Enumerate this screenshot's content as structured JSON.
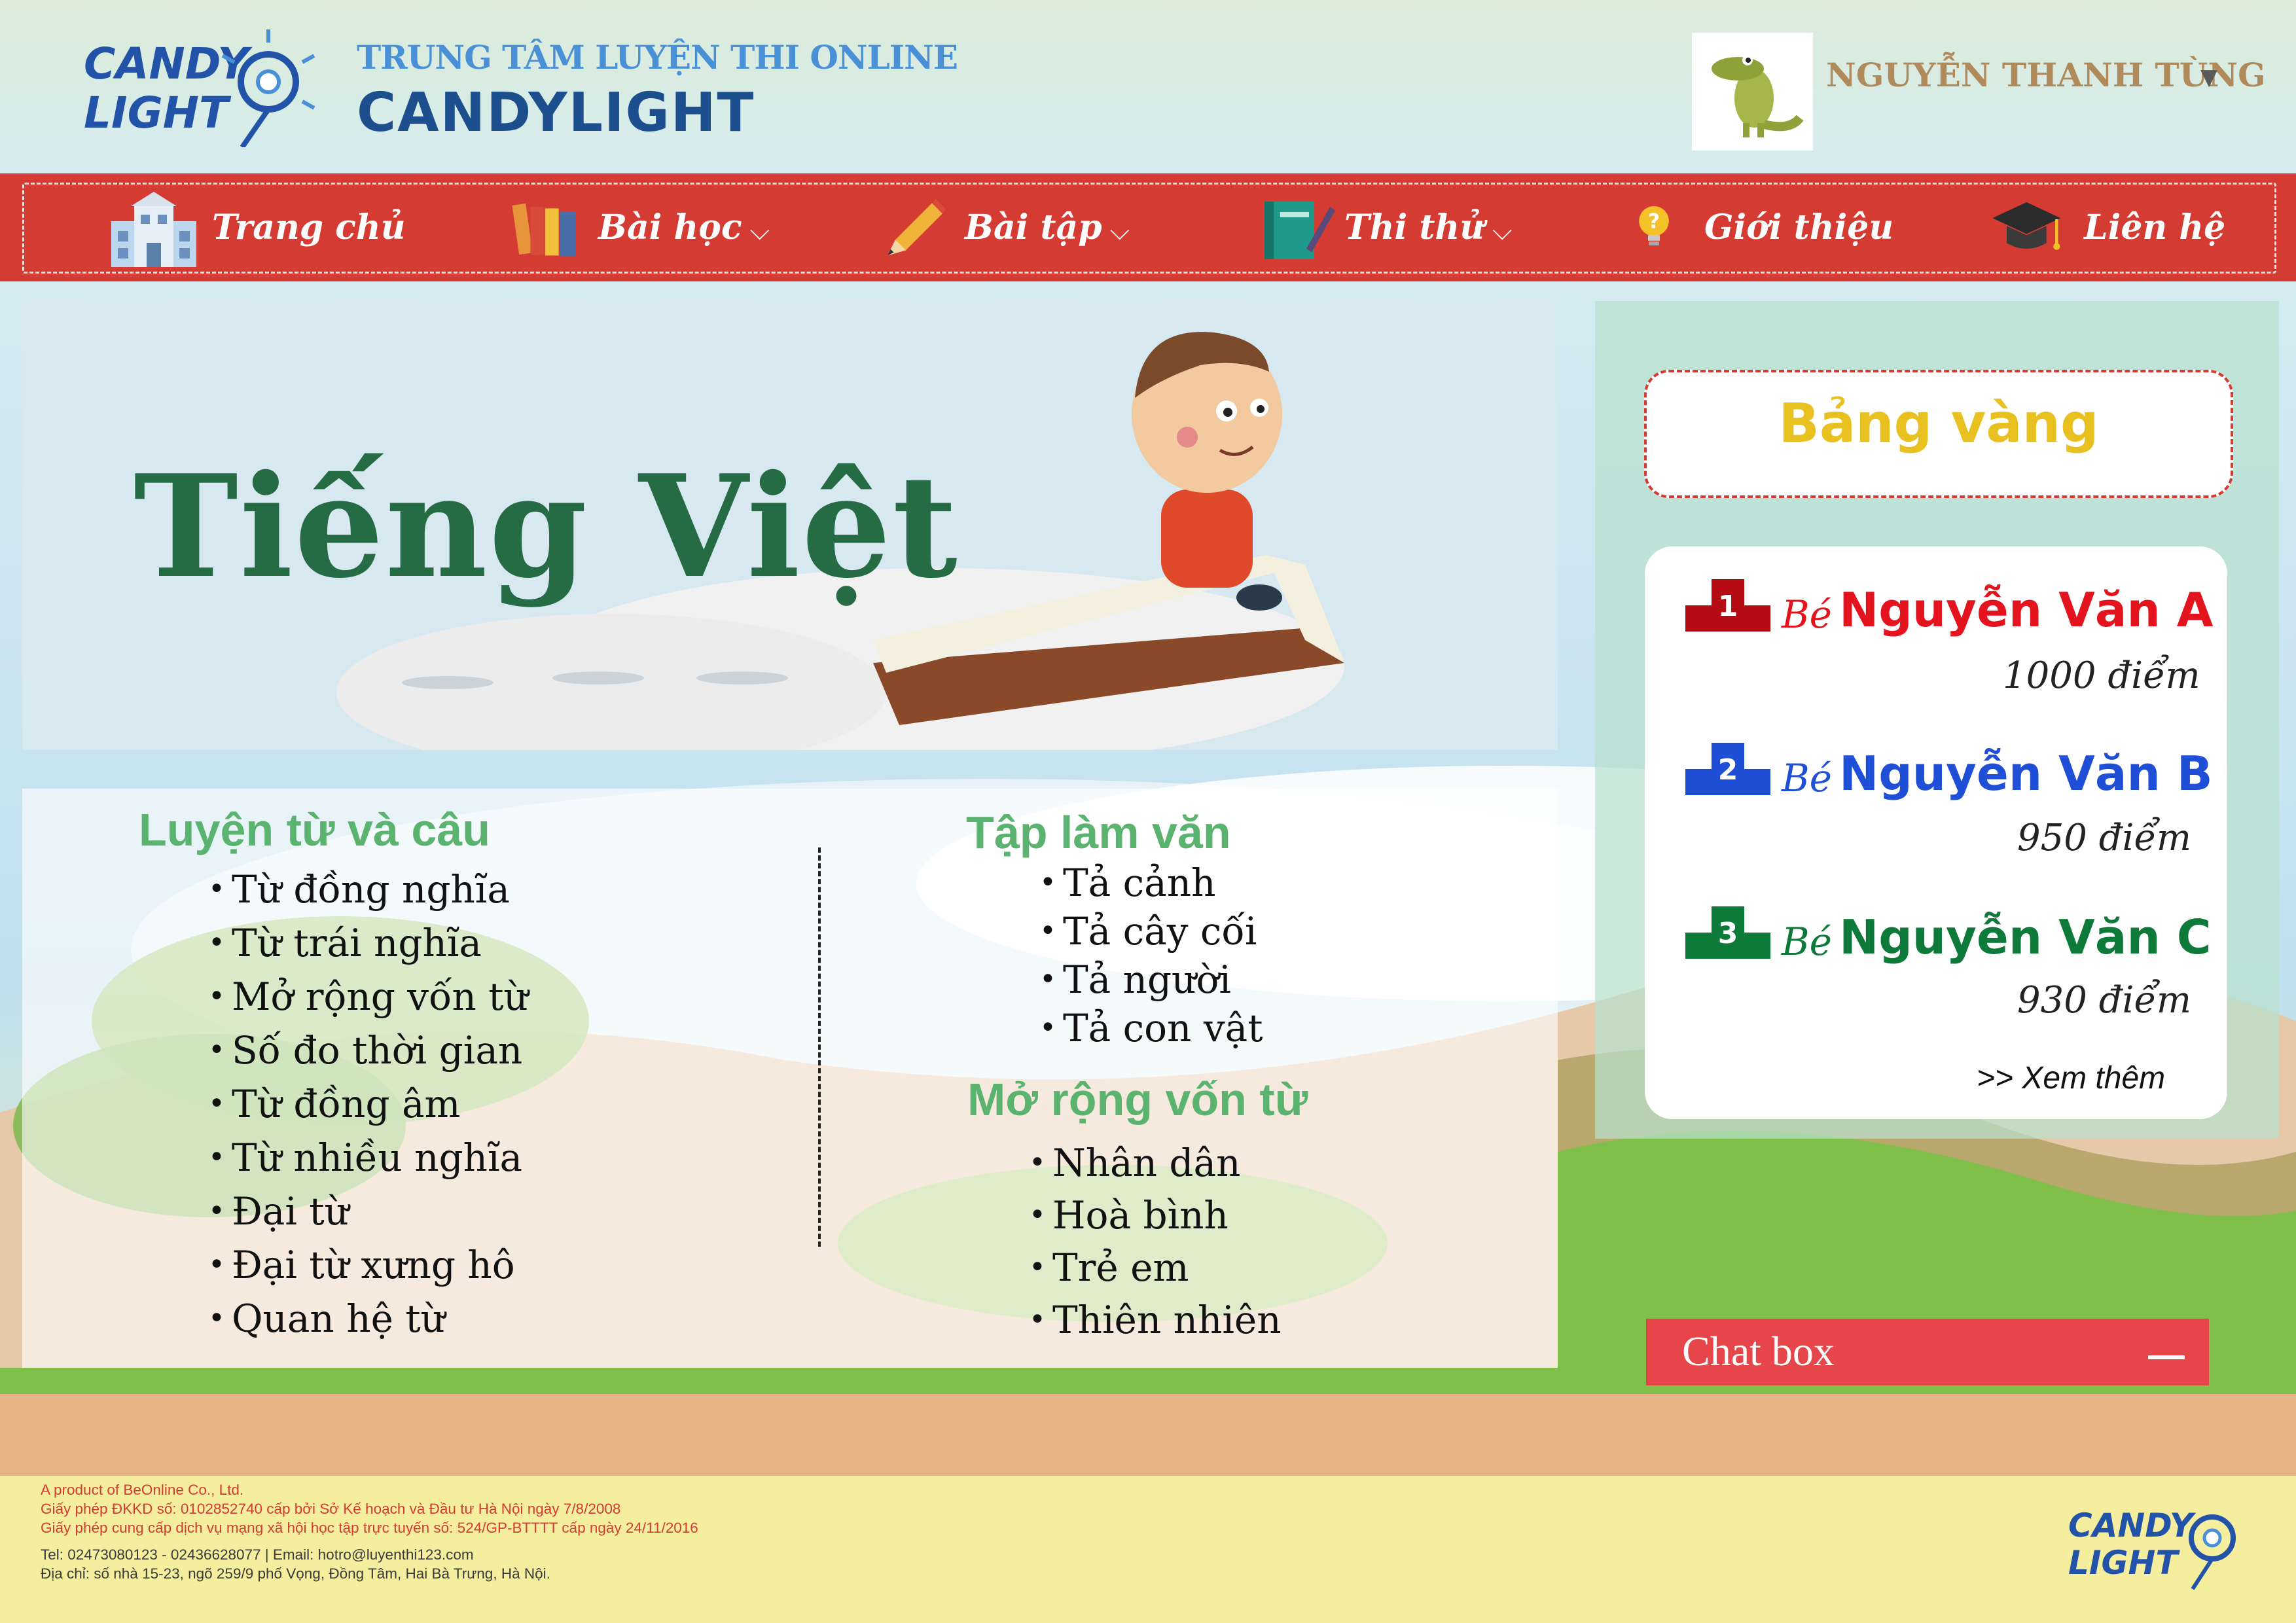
{
  "header": {
    "logo_lines": [
      "CANDY",
      "LIGHT"
    ],
    "subtitle": "TRUNG TÂM LUYỆN THI ONLINE",
    "title": "CANDYLIGHT",
    "user_name": "NGUYỄN THANH TÙNG",
    "user_caret": "▼"
  },
  "nav": {
    "items": [
      {
        "label": "Trang chủ",
        "icon": "school-icon",
        "has_dropdown": false
      },
      {
        "label": "Bài học",
        "icon": "books-icon",
        "has_dropdown": true
      },
      {
        "label": "Bài tập",
        "icon": "pencil-icon",
        "has_dropdown": true
      },
      {
        "label": "Thi thử",
        "icon": "notebook-icon",
        "has_dropdown": true
      },
      {
        "label": "Giới thiệu",
        "icon": "question-bulb-icon",
        "has_dropdown": false
      },
      {
        "label": "Liên hệ",
        "icon": "graduation-cap-icon",
        "has_dropdown": false
      }
    ],
    "chevron": "⌵"
  },
  "banner": {
    "title": "Tiếng Việt"
  },
  "sections": {
    "luyen_tu_va_cau": {
      "title": "Luyện từ và câu",
      "items": [
        "Từ đồng nghĩa",
        "Từ trái nghĩa",
        "Mở rộng vốn từ",
        "Số đo thời gian",
        "Từ đồng âm",
        "Từ nhiều nghĩa",
        "Đại từ",
        "Đại từ xưng hô",
        "Quan hệ từ"
      ]
    },
    "tap_lam_van": {
      "title": "Tập làm văn",
      "items": [
        "Tả cảnh",
        "Tả cây cối",
        "Tả người",
        "Tả con vật"
      ]
    },
    "mo_rong_von_tu": {
      "title": "Mở rộng vốn từ",
      "items": [
        "Nhân dân",
        "Hoà bình",
        "Trẻ em",
        "Thiên nhiên"
      ]
    }
  },
  "leaderboard": {
    "title": "Bảng vàng",
    "prefix": "Bé",
    "entries": [
      {
        "rank": "1",
        "name": "Nguyễn Văn A",
        "score": "1000 điểm",
        "color": "#e3141e",
        "badge_color": "#b40c12"
      },
      {
        "rank": "2",
        "name": "Nguyễn Văn B",
        "score": "950 điểm",
        "color": "#1f4fd6",
        "badge_color": "#1f4fd6"
      },
      {
        "rank": "3",
        "name": "Nguyễn Văn C",
        "score": "930 điểm",
        "color": "#0d7a3a",
        "badge_color": "#0d7a3a"
      }
    ],
    "see_more": ">> Xem thêm"
  },
  "chat": {
    "label": "Chat box",
    "minimize": "—"
  },
  "footer": {
    "lines": [
      "A product of BeOnline Co., Ltd.",
      "Giấy phép ĐKKD số: 0102852740 cấp bởi Sở Kế hoạch và Đầu tư Hà Nội ngày 7/8/2008",
      "Giấy phép cung cấp dịch vụ mạng xã hội học tập trực tuyến số: 524/GP-BTTTT cấp ngày 24/11/2016",
      "Tel: 02473080123 - 02436628077    |    Email: hotro@luyenthi123.com",
      "Địa chỉ: số nhà 15-23, ngõ 259/9 phố Vọng, Đồng Tâm, Hai Bà Trưng, Hà Nội."
    ]
  },
  "colors": {
    "nav_red": "#d33b33",
    "heading_green": "#256b44",
    "section_green": "#5ab36e",
    "gold": "#e8c020",
    "chat_red": "#e6464a"
  }
}
